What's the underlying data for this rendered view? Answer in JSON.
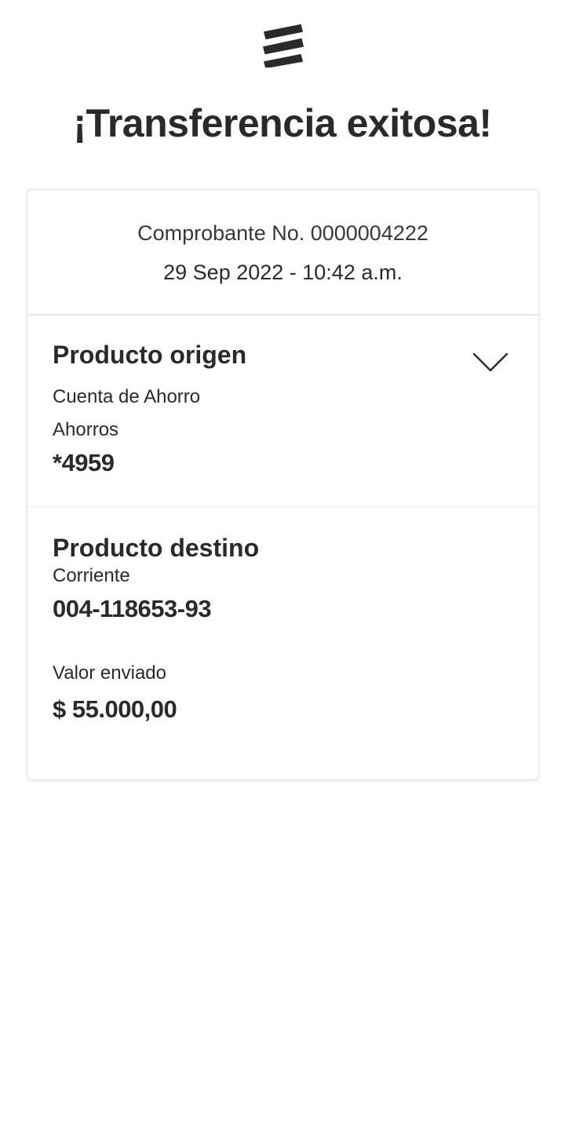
{
  "header": {
    "logo_icon": "bank-logo-icon",
    "title": "¡Transferencia exitosa!"
  },
  "receipt": {
    "number_label": "Comprobante No. 0000004222",
    "datetime": "29 Sep 2022 - 10:42 a.m."
  },
  "origin": {
    "title": "Producto origen",
    "account_type": "Cuenta de Ahorro",
    "account_subtype": "Ahorros",
    "account_number": "*4959",
    "toggle_icon": "chevron-down-icon"
  },
  "destination": {
    "title": "Producto destino",
    "account_type": "Corriente",
    "account_number": "004-118653-93"
  },
  "amount": {
    "label": "Valor enviado",
    "value": "$ 55.000,00"
  },
  "colors": {
    "text": "#2c2a29",
    "divider": "#e6e6e6",
    "background": "#ffffff"
  }
}
